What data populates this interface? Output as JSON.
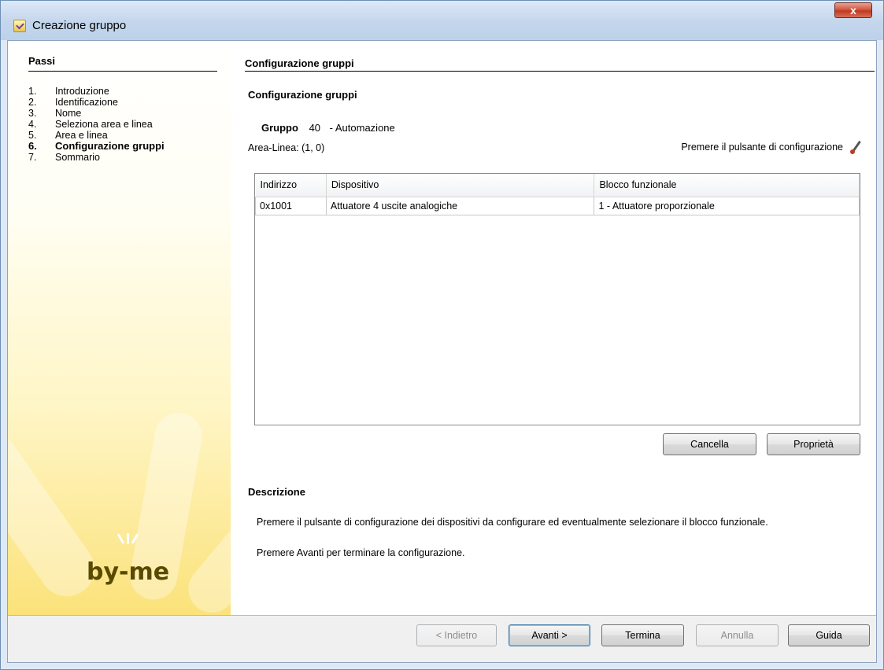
{
  "window": {
    "title": "Creazione gruppo",
    "close_label": "x"
  },
  "steps": {
    "title": "Passi",
    "items": [
      {
        "num": "1.",
        "label": "Introduzione"
      },
      {
        "num": "2.",
        "label": "Identificazione"
      },
      {
        "num": "3.",
        "label": "Nome"
      },
      {
        "num": "4.",
        "label": "Seleziona area e linea"
      },
      {
        "num": "5.",
        "label": "Area e linea"
      },
      {
        "num": "6.",
        "label": "Configurazione gruppi"
      },
      {
        "num": "7.",
        "label": "Sommario"
      }
    ],
    "active_index": 5,
    "logo_text": "by-me"
  },
  "content": {
    "header_title": "Configurazione gruppi",
    "section_title": "Configurazione gruppi",
    "group_label": "Gruppo",
    "group_number": "40",
    "group_name": "- Automazione",
    "area_line": "Area-Linea: (1, 0)",
    "config_hint": "Premere il pulsante di configurazione",
    "table": {
      "columns": [
        "Indirizzo",
        "Dispositivo",
        "Blocco funzionale"
      ],
      "rows": [
        [
          "0x1001",
          "Attuatore 4 uscite analogiche",
          "1 - Attuatore proporzionale"
        ]
      ]
    },
    "delete_button": "Cancella",
    "properties_button": "Proprietà",
    "description_title": "Descrizione",
    "description_line1": "Premere il pulsante di configurazione dei dispositivi da configurare ed eventualmente selezionare il blocco funzionale.",
    "description_line2": "Premere Avanti per terminare la configurazione."
  },
  "footer": {
    "back_label": "< Indietro",
    "next_label": "Avanti >",
    "finish_label": "Termina",
    "cancel_label": "Annulla",
    "help_label": "Guida"
  }
}
